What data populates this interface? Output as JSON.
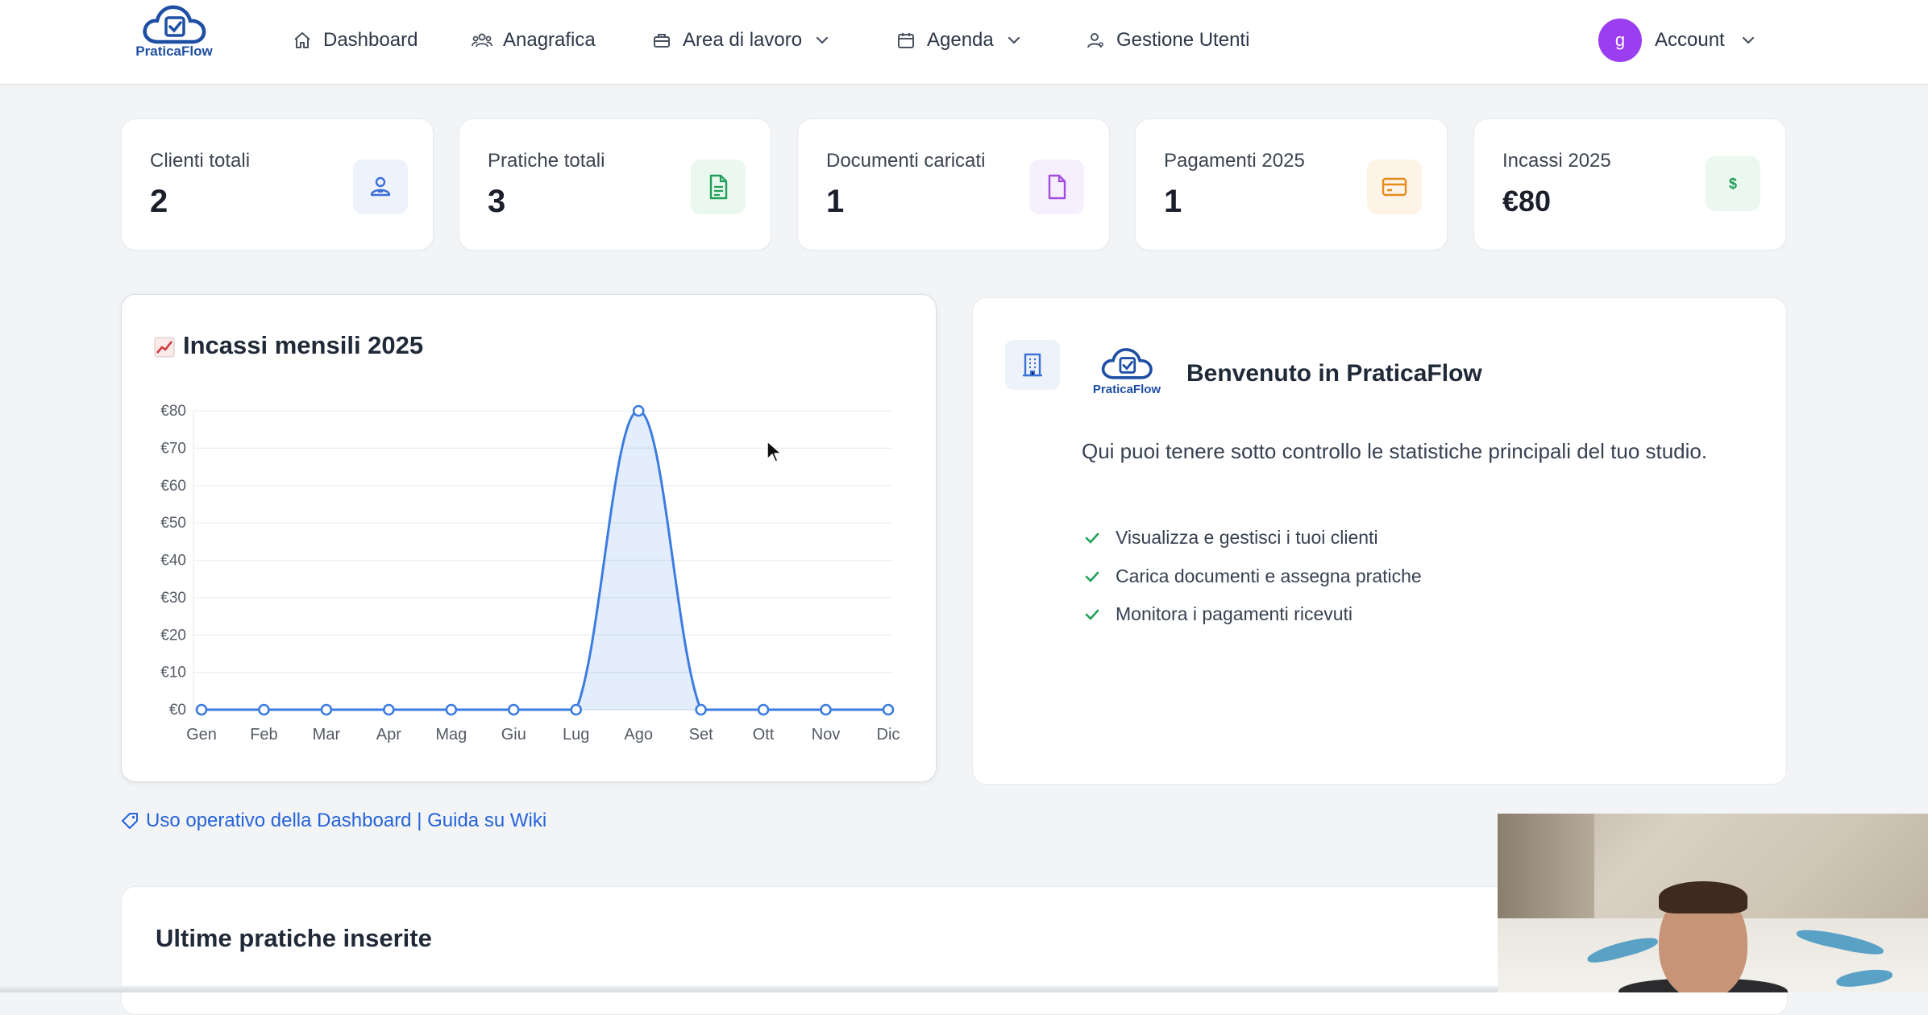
{
  "brand": {
    "name": "PraticaFlow"
  },
  "nav": {
    "items": [
      {
        "label": "Dashboard",
        "icon": "home-icon"
      },
      {
        "label": "Anagrafica",
        "icon": "users-icon"
      },
      {
        "label": "Area di lavoro",
        "icon": "briefcase-icon",
        "has_dropdown": true
      },
      {
        "label": "Agenda",
        "icon": "calendar-icon",
        "has_dropdown": true
      },
      {
        "label": "Gestione Utenti",
        "icon": "user-manage-icon"
      }
    ],
    "account": {
      "avatar_letter": "g",
      "label": "Account",
      "avatar_color": "#9b3df0"
    }
  },
  "stats": [
    {
      "label": "Clienti totali",
      "value": "2",
      "icon": "user-icon",
      "icon_bg": "#eef2fb",
      "icon_color": "#3b6fd8"
    },
    {
      "label": "Pratiche totali",
      "value": "3",
      "icon": "file-text-icon",
      "icon_bg": "#eaf8ef",
      "icon_color": "#22a05b"
    },
    {
      "label": "Documenti caricati",
      "value": "1",
      "icon": "document-icon",
      "icon_bg": "#f6effd",
      "icon_color": "#a24de0"
    },
    {
      "label": "Pagamenti 2025",
      "value": "1",
      "icon": "credit-card-icon",
      "icon_bg": "#fdf3e6",
      "icon_color": "#e58b1c"
    },
    {
      "label": "Incassi 2025",
      "value": "€80",
      "icon": "dollar-icon",
      "icon_bg": "#eaf8ef",
      "icon_color": "#1f9d55"
    }
  ],
  "chart_card": {
    "title": "Incassi mensili 2025",
    "title_icon": "chart-increasing-icon"
  },
  "chart_data": {
    "type": "area",
    "title": "Incassi mensili 2025",
    "categories": [
      "Gen",
      "Feb",
      "Mar",
      "Apr",
      "Mag",
      "Giu",
      "Lug",
      "Ago",
      "Set",
      "Ott",
      "Nov",
      "Dic"
    ],
    "series": [
      {
        "values": [
          0,
          0,
          0,
          0,
          0,
          0,
          0,
          80,
          0,
          0,
          0,
          0
        ],
        "color": "#3c7ce0"
      }
    ],
    "y_ticks": [
      "€0",
      "€10",
      "€20",
      "€30",
      "€40",
      "€50",
      "€60",
      "€70",
      "€80"
    ],
    "ylim": [
      0,
      80
    ],
    "grid": true,
    "legend": "none"
  },
  "welcome": {
    "title": "Benvenuto in PraticaFlow",
    "description": "Qui puoi tenere sotto controllo le statistiche principali del tuo studio.",
    "features": [
      "Visualizza e gestisci i tuoi clienti",
      "Carica documenti e assegna pratiche",
      "Monitora i pagamenti ricevuti"
    ]
  },
  "wiki_link": {
    "label": "Uso operativo della Dashboard | Guida su Wiki",
    "icon": "tag-icon"
  },
  "latest": {
    "title": "Ultime pratiche inserite"
  }
}
